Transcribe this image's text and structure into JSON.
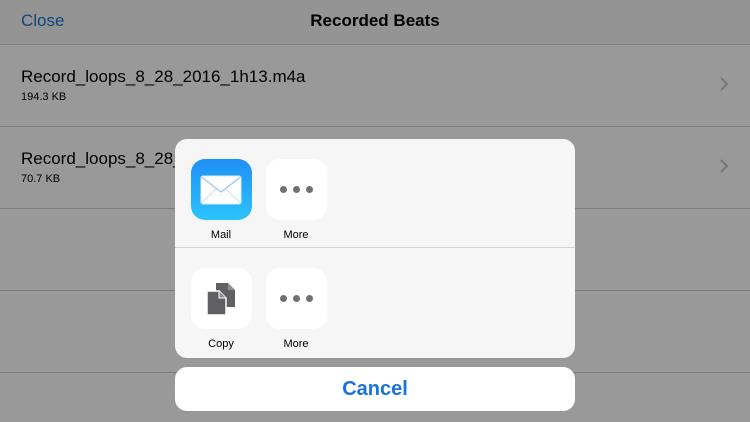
{
  "navbar": {
    "close_label": "Close",
    "title": "Recorded Beats"
  },
  "recordings": [
    {
      "name": "Record_loops_8_28_2016_1h13.m4a",
      "size": "194.3 KB"
    },
    {
      "name": "Record_loops_8_28_",
      "size": "70.7 KB"
    }
  ],
  "share_sheet": {
    "row1": [
      {
        "label": "Mail",
        "icon": "mail-icon"
      },
      {
        "label": "More",
        "icon": "more-icon"
      }
    ],
    "row2": [
      {
        "label": "Copy",
        "icon": "copy-icon"
      },
      {
        "label": "More",
        "icon": "more-icon"
      }
    ],
    "cancel_label": "Cancel"
  },
  "colors": {
    "tint": "#1a73d9",
    "mail_gradient_top": "#1f8ff7",
    "mail_gradient_bottom": "#2bc3fb"
  }
}
